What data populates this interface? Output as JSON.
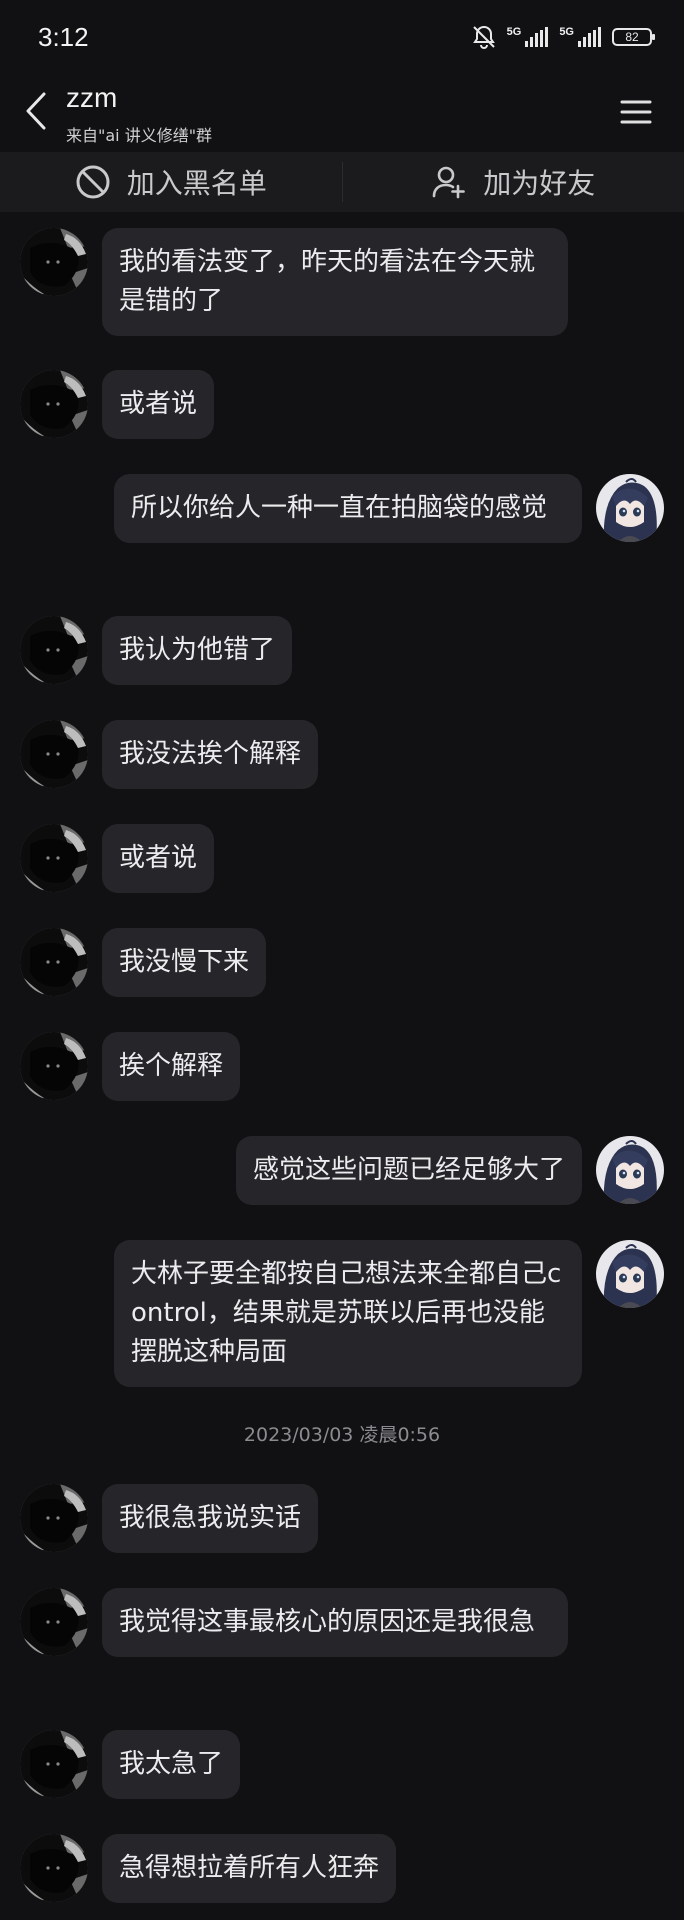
{
  "status": {
    "time": "3:12",
    "network1": "5G",
    "network2": "5G",
    "battery": "82"
  },
  "header": {
    "name": "zzm",
    "subtitle": "来自\"ai 讲义修缮\"群"
  },
  "actions": {
    "blacklist": "加入黑名单",
    "add_friend": "加为好友"
  },
  "messages": [
    {
      "side": "left",
      "text": "我的看法变了，昨天的看法在今天就是错的了"
    },
    {
      "side": "left",
      "text": "或者说"
    },
    {
      "side": "right",
      "text": "所以你给人一种一直在拍脑袋的感觉"
    },
    {
      "side": "left",
      "text": "我认为他错了"
    },
    {
      "side": "left",
      "text": "我没法挨个解释"
    },
    {
      "side": "left",
      "text": "或者说"
    },
    {
      "side": "left",
      "text": "我没慢下来"
    },
    {
      "side": "left",
      "text": "挨个解释"
    },
    {
      "side": "right",
      "text": "感觉这些问题已经足够大了"
    },
    {
      "side": "right",
      "text": "大林子要全都按自己想法来全都自己control，结果就是苏联以后再也没能摆脱这种局面"
    },
    {
      "side": "left",
      "text": "我很急我说实话"
    },
    {
      "side": "left",
      "text": "我觉得这事最核心的原因还是我很急"
    },
    {
      "side": "left",
      "text": "我太急了"
    },
    {
      "side": "left",
      "text": "急得想拉着所有人狂奔"
    }
  ],
  "timestamp": "2023/03/03 凌晨0:56"
}
